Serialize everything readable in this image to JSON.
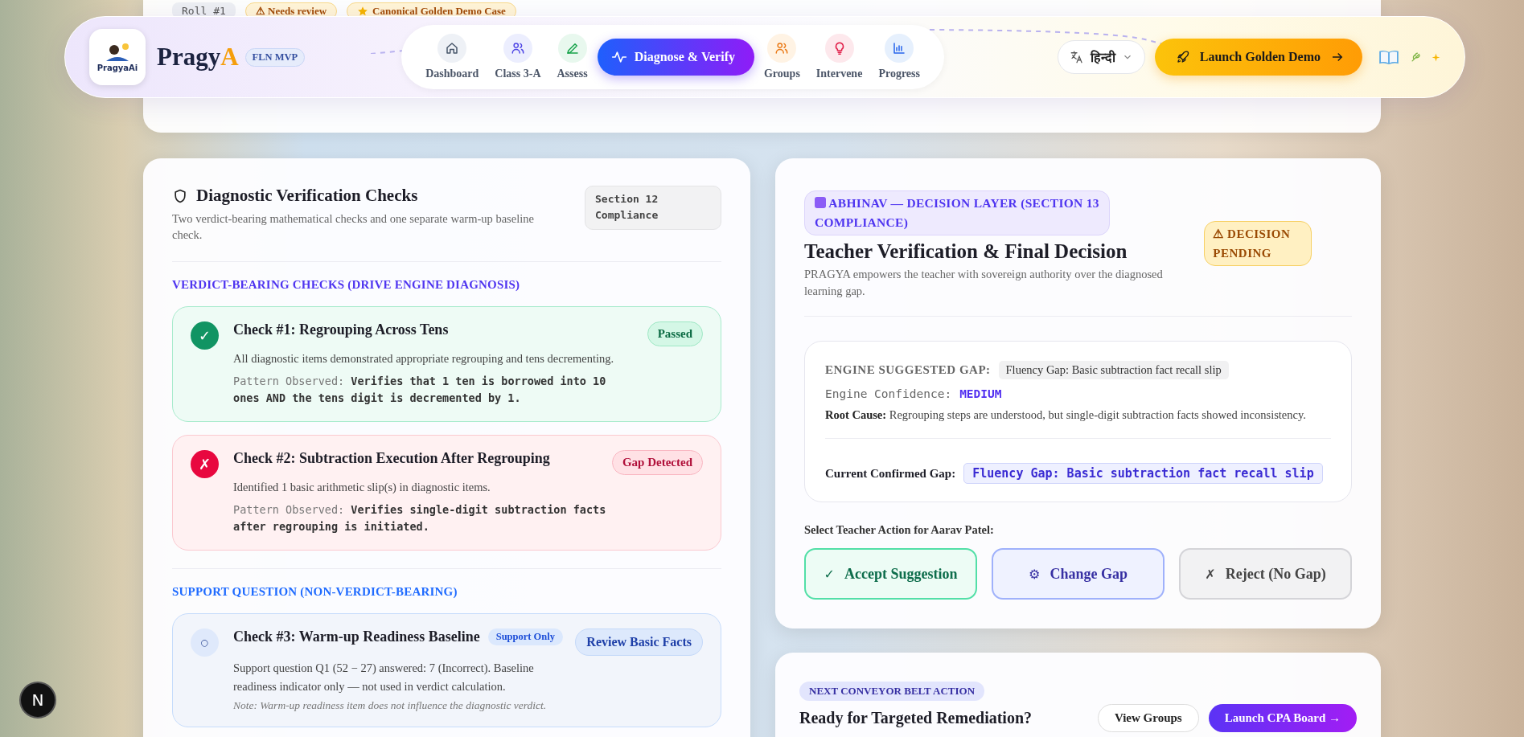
{
  "top_card": {
    "badges": [
      {
        "kind": "roll",
        "label": "Roll #1"
      },
      {
        "kind": "warn",
        "label": "⚠ Needs review"
      },
      {
        "kind": "star",
        "label": "Canonical Golden Demo Case"
      }
    ]
  },
  "header": {
    "logo_text": "PragyaAi",
    "brand": "Pragy",
    "brand_accent": "A",
    "badge": "FLN MVP",
    "nav": [
      {
        "label": "Dashboard",
        "selected": false
      },
      {
        "label": "Class 3-A",
        "selected": false
      },
      {
        "label": "Assess",
        "selected": false
      },
      {
        "label": "Diagnose & Verify",
        "selected": true
      },
      {
        "label": "Groups",
        "selected": false
      },
      {
        "label": "Intervene",
        "selected": false
      },
      {
        "label": "Progress",
        "selected": false
      }
    ],
    "language": "हिन्दी",
    "launch_button": "Launch Golden Demo"
  },
  "checks_card": {
    "title": "Diagnostic Verification Checks",
    "subtitle": "Two verdict-bearing mathematical checks and one separate warm-up baseline check.",
    "section_badge": "Section 12 Compliance",
    "groups": [
      {
        "heading": "VERDICT-BEARING CHECKS (DRIVE ENGINE DIAGNOSIS)",
        "kind": "verdict",
        "checks": [
          {
            "kind": "passed",
            "symbol": "✓",
            "title": "Check #1: Regrouping Across Tens",
            "status": "Passed",
            "description": "All diagnostic items demonstrated appropriate regrouping and tens decrementing.",
            "pattern_label": "Pattern Observed:",
            "pattern": "Verifies that 1 ten is borrowed into 10 ones AND the tens digit is decremented by 1."
          },
          {
            "kind": "gap",
            "symbol": "✗",
            "title": "Check #2: Subtraction Execution After Regrouping",
            "status": "Gap Detected",
            "description": "Identified 1 basic arithmetic slip(s) in diagnostic items.",
            "pattern_label": "Pattern Observed:",
            "pattern": "Verifies single-digit subtraction facts after regrouping is initiated."
          }
        ]
      },
      {
        "heading": "SUPPORT QUESTION (NON-VERDICT-BEARING)",
        "kind": "support",
        "checks": [
          {
            "kind": "support",
            "symbol": "○",
            "title": "Check #3: Warm-up Readiness Baseline",
            "tag": "Support Only",
            "status": "Review Basic Facts",
            "description": "Support question Q1 (52 − 27) answered: 7 (Incorrect). Baseline readiness indicator only — not used in verdict calculation.",
            "note": "Note: Warm-up readiness item does not influence the diagnostic verdict."
          }
        ]
      }
    ]
  },
  "decision_card": {
    "layer_badge": "ABHINAV — DECISION LAYER (SECTION 13 COMPLIANCE)",
    "title": "Teacher Verification & Final Decision",
    "subtitle": "PRAGYA empowers the teacher with sovereign authority over the diagnosed learning gap.",
    "status_badge": "⚠ DECISION PENDING",
    "engine_gap_label": "ENGINE SUGGESTED GAP:",
    "engine_gap": "Fluency Gap: Basic subtraction fact recall slip",
    "confidence_label": "Engine Confidence:",
    "confidence": "MEDIUM",
    "root_cause": "**Root Cause:** Regrouping steps are understood, but single-digit subtraction facts showed inconsistency.",
    "confirmed_label": "Current Confirmed Gap:",
    "confirmed_gap": "Fluency Gap: Basic subtraction fact recall slip",
    "action_prompt": "Select Teacher Action for Aarav Patel:",
    "actions": [
      {
        "kind": "accept",
        "symbol": "✓",
        "label": "Accept Suggestion"
      },
      {
        "kind": "change",
        "symbol": "⚙",
        "label": "Change Gap"
      },
      {
        "kind": "reject",
        "symbol": "✗",
        "label": "Reject (No Gap)"
      }
    ]
  },
  "next_card": {
    "badge": "NEXT CONVEYOR BELT ACTION",
    "title": "Ready for Targeted Remediation?",
    "buttons": [
      {
        "kind": "secondary",
        "label": "View Groups"
      },
      {
        "kind": "primary",
        "label": "Launch CPA Board →"
      }
    ]
  },
  "dev_badge": "N"
}
